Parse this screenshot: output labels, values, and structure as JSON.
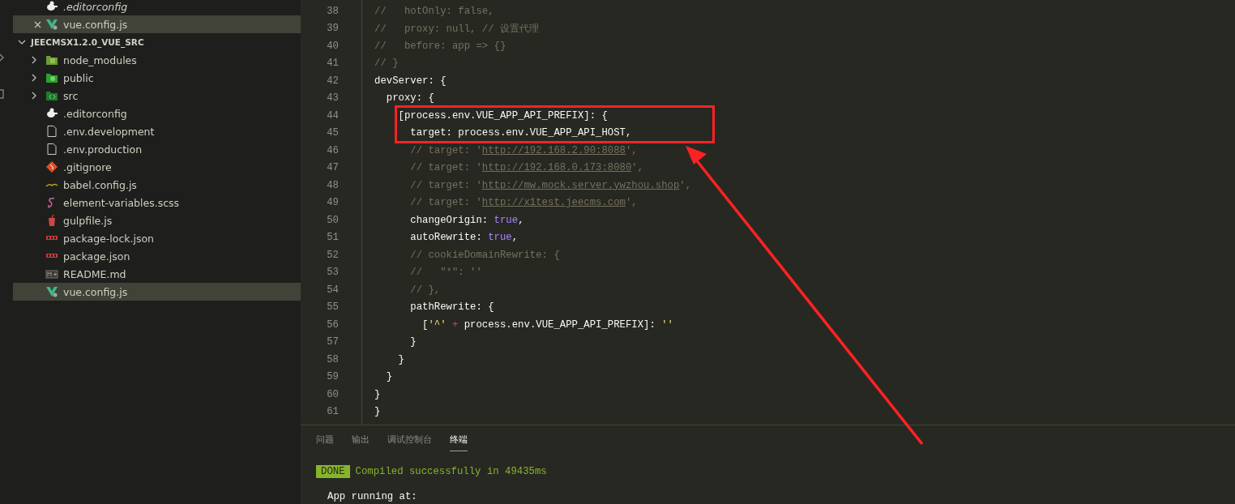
{
  "open_editors": [
    {
      "name": ".editorconfig",
      "kind": "editorconfig",
      "selected": false
    },
    {
      "name": "vue.config.js",
      "kind": "vue",
      "selected": true
    }
  ],
  "explorer": {
    "title": "JEECMSX1.2.0_VUE_SRC",
    "expanded": true,
    "items": [
      {
        "name": "node_modules",
        "kind": "nodefolder",
        "expanded": false,
        "selected": false
      },
      {
        "name": "public",
        "kind": "publicfolder",
        "expanded": false,
        "selected": false
      },
      {
        "name": "src",
        "kind": "srcfolder",
        "expanded": false,
        "selected": false
      },
      {
        "name": ".editorconfig",
        "kind": "editorconfig",
        "selected": false
      },
      {
        "name": ".env.development",
        "kind": "file",
        "selected": false
      },
      {
        "name": ".env.production",
        "kind": "file",
        "selected": false
      },
      {
        "name": ".gitignore",
        "kind": "git",
        "selected": false
      },
      {
        "name": "babel.config.js",
        "kind": "babel",
        "selected": false
      },
      {
        "name": "element-variables.scss",
        "kind": "sass",
        "selected": false
      },
      {
        "name": "gulpfile.js",
        "kind": "gulp",
        "selected": false
      },
      {
        "name": "package-lock.json",
        "kind": "npm",
        "selected": false
      },
      {
        "name": "package.json",
        "kind": "npm",
        "selected": false
      },
      {
        "name": "README.md",
        "kind": "markdown",
        "selected": false
      },
      {
        "name": "vue.config.js",
        "kind": "vue",
        "selected": true
      }
    ]
  },
  "code_lines": [
    {
      "number": "38",
      "tokens": [
        {
          "kind": "comment",
          "text": "//   hotOnly: false,"
        }
      ]
    },
    {
      "number": "39",
      "tokens": [
        {
          "kind": "comment",
          "text": "//   proxy: null, // 设置代理"
        }
      ]
    },
    {
      "number": "40",
      "tokens": [
        {
          "kind": "comment",
          "text": "//   before: app => {}"
        }
      ]
    },
    {
      "number": "41",
      "tokens": [
        {
          "kind": "comment",
          "text": "// }"
        }
      ]
    },
    {
      "number": "42",
      "tokens": [
        {
          "kind": "plain",
          "text": "devServer: {"
        }
      ]
    },
    {
      "number": "43",
      "tokens": [
        {
          "kind": "plain",
          "text": "  proxy: {"
        }
      ]
    },
    {
      "number": "44",
      "tokens": [
        {
          "kind": "plain",
          "text": "    [process.env.VUE_APP_API_PREFIX]: {"
        }
      ]
    },
    {
      "number": "45",
      "tokens": [
        {
          "kind": "plain",
          "text": "      target: process.env.VUE_APP_API_HOST,"
        }
      ]
    },
    {
      "number": "46",
      "tokens": [
        {
          "kind": "comment",
          "text": "      // target: '"
        },
        {
          "kind": "link",
          "text": "http://192.168.2.90:8088"
        },
        {
          "kind": "comment",
          "text": "',"
        }
      ]
    },
    {
      "number": "47",
      "tokens": [
        {
          "kind": "comment",
          "text": "      // target: '"
        },
        {
          "kind": "link",
          "text": "http://192.168.0.173:8080"
        },
        {
          "kind": "comment",
          "text": "',"
        }
      ]
    },
    {
      "number": "48",
      "tokens": [
        {
          "kind": "comment",
          "text": "      // target: '"
        },
        {
          "kind": "link",
          "text": "http://mw.mock.server.ywzhou.shop"
        },
        {
          "kind": "comment",
          "text": "',"
        }
      ]
    },
    {
      "number": "49",
      "tokens": [
        {
          "kind": "comment",
          "text": "      // target: '"
        },
        {
          "kind": "link",
          "text": "http://x1test.jeecms.com"
        },
        {
          "kind": "comment",
          "text": "',"
        }
      ]
    },
    {
      "number": "50",
      "tokens": [
        {
          "kind": "plain",
          "text": "      changeOrigin: "
        },
        {
          "kind": "constant",
          "text": "true"
        },
        {
          "kind": "plain",
          "text": ","
        }
      ]
    },
    {
      "number": "51",
      "tokens": [
        {
          "kind": "plain",
          "text": "      autoRewrite: "
        },
        {
          "kind": "constant",
          "text": "true"
        },
        {
          "kind": "plain",
          "text": ","
        }
      ]
    },
    {
      "number": "52",
      "tokens": [
        {
          "kind": "comment",
          "text": "      // cookieDomainRewrite: {"
        }
      ]
    },
    {
      "number": "53",
      "tokens": [
        {
          "kind": "comment",
          "text": "      //   \"*\": ''"
        }
      ]
    },
    {
      "number": "54",
      "tokens": [
        {
          "kind": "comment",
          "text": "      // },"
        }
      ]
    },
    {
      "number": "55",
      "tokens": [
        {
          "kind": "plain",
          "text": "      pathRewrite: {"
        }
      ]
    },
    {
      "number": "56",
      "tokens": [
        {
          "kind": "plain",
          "text": "        ["
        },
        {
          "kind": "string",
          "text": "'^'"
        },
        {
          "kind": "operator",
          "text": " +"
        },
        {
          "kind": "plain",
          "text": " process.env.VUE_APP_API_PREFIX]: "
        },
        {
          "kind": "string",
          "text": "''"
        }
      ]
    },
    {
      "number": "57",
      "tokens": [
        {
          "kind": "plain",
          "text": "      }"
        }
      ]
    },
    {
      "number": "58",
      "tokens": [
        {
          "kind": "plain",
          "text": "    }"
        }
      ]
    },
    {
      "number": "59",
      "tokens": [
        {
          "kind": "plain",
          "text": "  }"
        }
      ]
    },
    {
      "number": "60",
      "tokens": [
        {
          "kind": "plain",
          "text": "}"
        }
      ]
    },
    {
      "number": "61",
      "tokens": [
        {
          "kind": "plain",
          "text": "}"
        }
      ]
    }
  ],
  "panel": {
    "tabs": [
      {
        "label": "问题",
        "selected": false
      },
      {
        "label": "输出",
        "selected": false
      },
      {
        "label": "调试控制台",
        "selected": false
      },
      {
        "label": "终端",
        "selected": true
      }
    ],
    "terminal": {
      "badge": "DONE",
      "message": "Compiled successfully in 49435ms",
      "lines": [
        "App running at:"
      ]
    }
  }
}
